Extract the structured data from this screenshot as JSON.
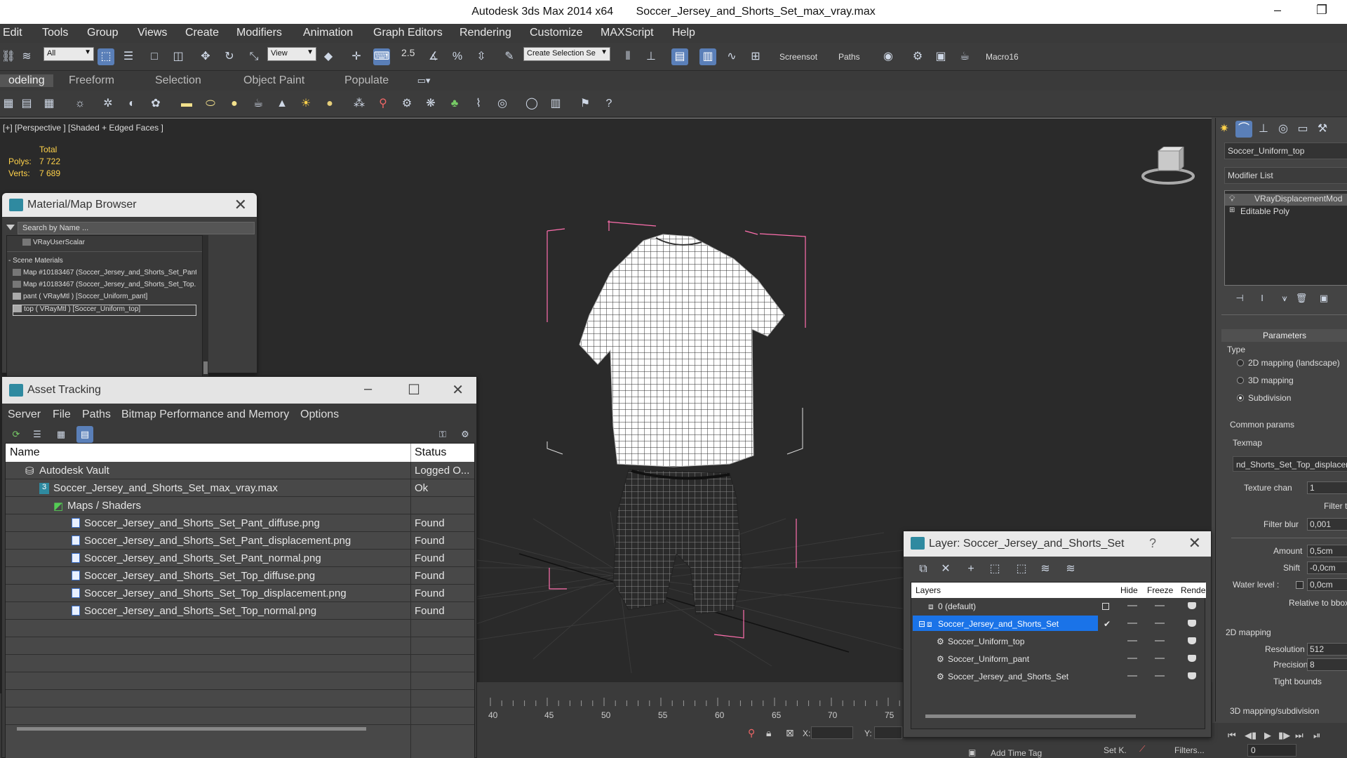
{
  "window": {
    "app_title": "Autodesk 3ds Max  2014 x64",
    "file_title": "Soccer_Jersey_and_Shorts_Set_max_vray.max",
    "minimize": "–",
    "restore": "❐"
  },
  "menu": [
    "Edit",
    "Tools",
    "Group",
    "Views",
    "Create",
    "Modifiers",
    "Animation",
    "Graph Editors",
    "Rendering",
    "Customize",
    "MAXScript",
    "Help"
  ],
  "toolbar": {
    "selection_filter": "All",
    "coord_system": "View",
    "snap_label": "2.5",
    "named_selection": "Create Selection Se",
    "screenshot_label": "Screensot",
    "paths_label": "Paths",
    "macro_label": "Macro16"
  },
  "ribbon_tabs": [
    "odeling",
    "Freeform",
    "Selection",
    "Object Paint",
    "Populate"
  ],
  "viewport": {
    "label": "[+] [Perspective ] [Shaded + Edged Faces ]",
    "stats": {
      "header": "Total",
      "polys_label": "Polys:",
      "polys": "7 722",
      "verts_label": "Verts:",
      "verts": "7 689"
    }
  },
  "material_browser": {
    "title": "Material/Map Browser",
    "search_placeholder": "Search by Name ...",
    "top_item": "VRayUserScalar",
    "group": "- Scene Materials",
    "items": [
      "Map #10183467 (Soccer_Jersey_and_Shorts_Set_Pant...",
      "Map #10183467 (Soccer_Jersey_and_Shorts_Set_Top...",
      "pant  ( VRayMtl ) [Soccer_Uniform_pant]",
      "top  ( VRayMtl ) [Soccer_Uniform_top]"
    ]
  },
  "asset_tracking": {
    "title": "Asset Tracking",
    "menu": [
      "Server",
      "File",
      "Paths",
      "Bitmap Performance and Memory",
      "Options"
    ],
    "columns": {
      "name": "Name",
      "status": "Status"
    },
    "rows": [
      {
        "name": "Autodesk Vault",
        "status": "Logged O..."
      },
      {
        "name": "Soccer_Jersey_and_Shorts_Set_max_vray.max",
        "status": "Ok"
      },
      {
        "name": "Maps / Shaders",
        "status": ""
      },
      {
        "name": "Soccer_Jersey_and_Shorts_Set_Pant_diffuse.png",
        "status": "Found"
      },
      {
        "name": "Soccer_Jersey_and_Shorts_Set_Pant_displacement.png",
        "status": "Found"
      },
      {
        "name": "Soccer_Jersey_and_Shorts_Set_Pant_normal.png",
        "status": "Found"
      },
      {
        "name": "Soccer_Jersey_and_Shorts_Set_Top_diffuse.png",
        "status": "Found"
      },
      {
        "name": "Soccer_Jersey_and_Shorts_Set_Top_displacement.png",
        "status": "Found"
      },
      {
        "name": "Soccer_Jersey_and_Shorts_Set_Top_normal.png",
        "status": "Found"
      }
    ]
  },
  "layer_window": {
    "title": "Layer: Soccer_Jersey_and_Shorts_Set",
    "help": "?",
    "columns": {
      "layers": "Layers",
      "hide": "Hide",
      "freeze": "Freeze",
      "render": "Rende"
    },
    "rows": [
      "0 (default)",
      "Soccer_Jersey_and_Shorts_Set",
      "Soccer_Uniform_top",
      "Soccer_Uniform_pant",
      "Soccer_Jersey_and_Shorts_Set"
    ]
  },
  "timeline": {
    "ticks": [
      "40",
      "45",
      "50",
      "55",
      "60",
      "65",
      "70",
      "75"
    ]
  },
  "status": {
    "x_label": "X:",
    "y_label": "Y:",
    "add_time_tag": "Add Time Tag",
    "set_key": "Set K.",
    "filters": "Filters...",
    "frame": "0"
  },
  "command_panel": {
    "object_name": "Soccer_Uniform_top",
    "modifier_list": "Modifier List",
    "stack": [
      "VRayDisplacementMod",
      "Editable Poly"
    ],
    "parameters": "Parameters",
    "type_label": "Type",
    "types": [
      "2D mapping (landscape)",
      "3D mapping",
      "Subdivision"
    ],
    "common_params": "Common params",
    "texmap_label": "Texmap",
    "texmap_value": "nd_Shorts_Set_Top_displacemen",
    "texture_chan_label": "Texture chan",
    "texture_chan": "1",
    "filter_texmap": "Filter texmap",
    "filter_blur_label": "Filter blur",
    "filter_blur": "0,001",
    "amount_label": "Amount",
    "amount": "0,5cm",
    "shift_label": "Shift",
    "shift": "-0,0cm",
    "water_label": "Water level :",
    "water": "0,0cm",
    "relative": "Relative to bbox",
    "mapping_2d": "2D mapping",
    "resolution_label": "Resolution",
    "resolution": "512",
    "precision_label": "Precision",
    "precision": "8",
    "tight_bounds": "Tight bounds",
    "mapping_3d": "3D mapping/subdivision"
  }
}
